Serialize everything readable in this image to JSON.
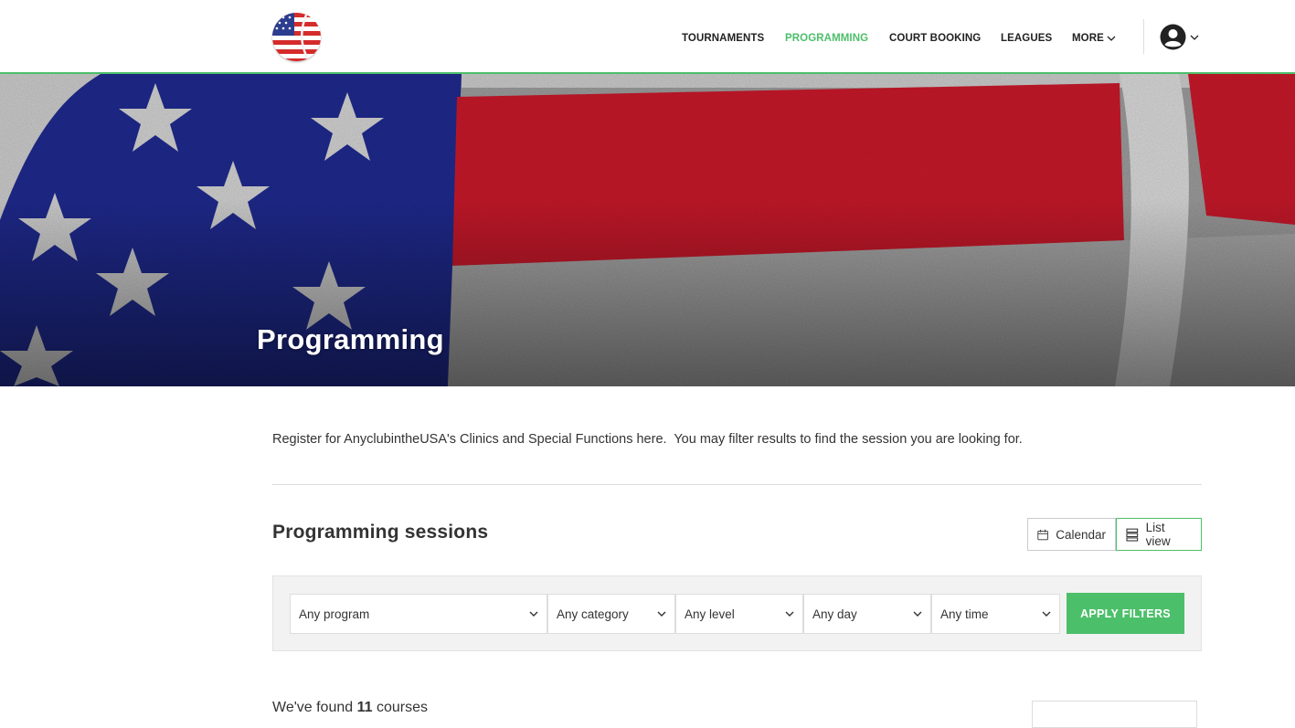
{
  "header": {
    "nav": [
      {
        "label": "TOURNAMENTS",
        "active": false
      },
      {
        "label": "PROGRAMMING",
        "active": true
      },
      {
        "label": "COURT BOOKING",
        "active": false
      },
      {
        "label": "LEAGUES",
        "active": false
      },
      {
        "label": "MORE",
        "active": false,
        "has_dropdown": true
      }
    ],
    "account_icon": "user-circle-icon"
  },
  "hero": {
    "title": "Programming",
    "image": "usa-flag-tennis-ball"
  },
  "intro": {
    "text": "Register for AnyclubintheUSA's Clinics and Special Functions here.  You may filter results to find the session you are looking for."
  },
  "sessions": {
    "title": "Programming sessions",
    "views": {
      "calendar_label": "Calendar",
      "list_label": "List view",
      "active": "list"
    }
  },
  "filters": {
    "program": "Any program",
    "category": "Any category",
    "level": "Any level",
    "day": "Any day",
    "time": "Any time",
    "apply_label": "APPLY FILTERS"
  },
  "results": {
    "prefix": "We've found",
    "count": "11",
    "suffix": "courses"
  },
  "colors": {
    "accent": "#4cbf6a",
    "text": "#333333",
    "filter_bg": "#f2f2f2"
  }
}
